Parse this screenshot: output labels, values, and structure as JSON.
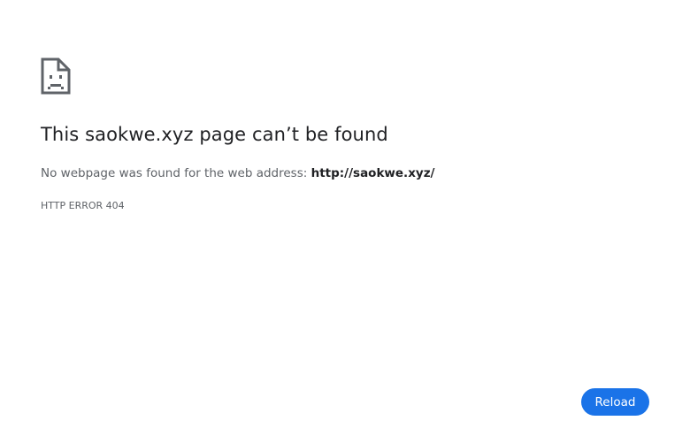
{
  "error_page": {
    "icon": "sad-document-icon",
    "title_prefix": "This ",
    "host": "saokwe.xyz",
    "title_suffix": " page can’t be found",
    "message_prefix": "No webpage was found for the web address: ",
    "url": "http://saokwe.xyz/",
    "error_code": "HTTP ERROR 404",
    "reload_label": "Reload"
  },
  "colors": {
    "text_primary": "#202124",
    "text_secondary": "#5f6368",
    "accent": "#1a73e8",
    "background": "#ffffff"
  }
}
